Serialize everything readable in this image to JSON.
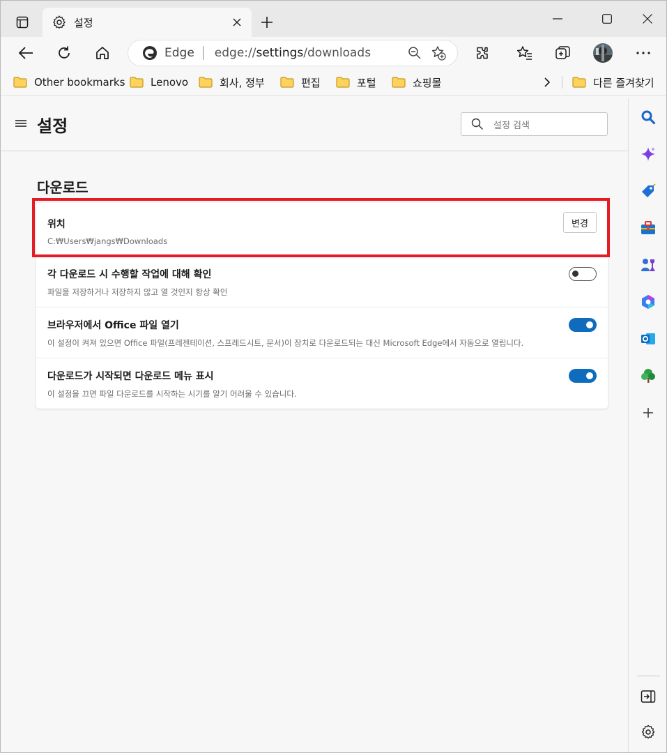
{
  "browser": {
    "tab": {
      "title": "설정"
    },
    "address": {
      "brand": "Edge",
      "url_prefix": "edge://",
      "url_path": "settings",
      "url_suffix": "/downloads"
    },
    "bookmarks": [
      "Other bookmarks",
      "Lenovo",
      "회사, 정부",
      "편집",
      "포털",
      "쇼핑몰"
    ],
    "other_favorites": "다른 즐겨찾기"
  },
  "settings": {
    "title": "설정",
    "search_placeholder": "설정 검색",
    "section_title": "다운로드",
    "location": {
      "label": "위치",
      "path": "C:₩Users₩jangs₩Downloads",
      "button": "변경"
    },
    "ask_each": {
      "label": "각 다운로드 시 수행할 작업에 대해 확인",
      "desc": "파일을 저장하거나 저장하지 않고 열 것인지 항상 확인",
      "enabled": false
    },
    "office_in_browser": {
      "label": "브라우저에서 Office 파일 열기",
      "desc": "이 설정이 켜져 있으면 Office 파일(프레젠테이션, 스프레드시트, 문서)이 장치로 다운로드되는 대신 Microsoft Edge에서 자동으로 열립니다.",
      "enabled": true
    },
    "show_menu": {
      "label": "다운로드가 시작되면 다운로드 메뉴 표시",
      "desc": "이 설정을 끄면 파일 다운로드를 시작하는 시기를 알기 어려울 수 있습니다.",
      "enabled": true
    }
  },
  "colors": {
    "accent": "#0f6cbd",
    "highlight": "#e51c23"
  },
  "icons": {
    "sidebar": [
      "search-icon",
      "copilot-icon",
      "shopping-tag-icon",
      "tools-briefcase-icon",
      "games-icon",
      "microsoft365-icon",
      "outlook-icon",
      "tree-icon",
      "add-icon",
      "hide-sidebar-icon",
      "sidebar-settings-icon"
    ]
  }
}
